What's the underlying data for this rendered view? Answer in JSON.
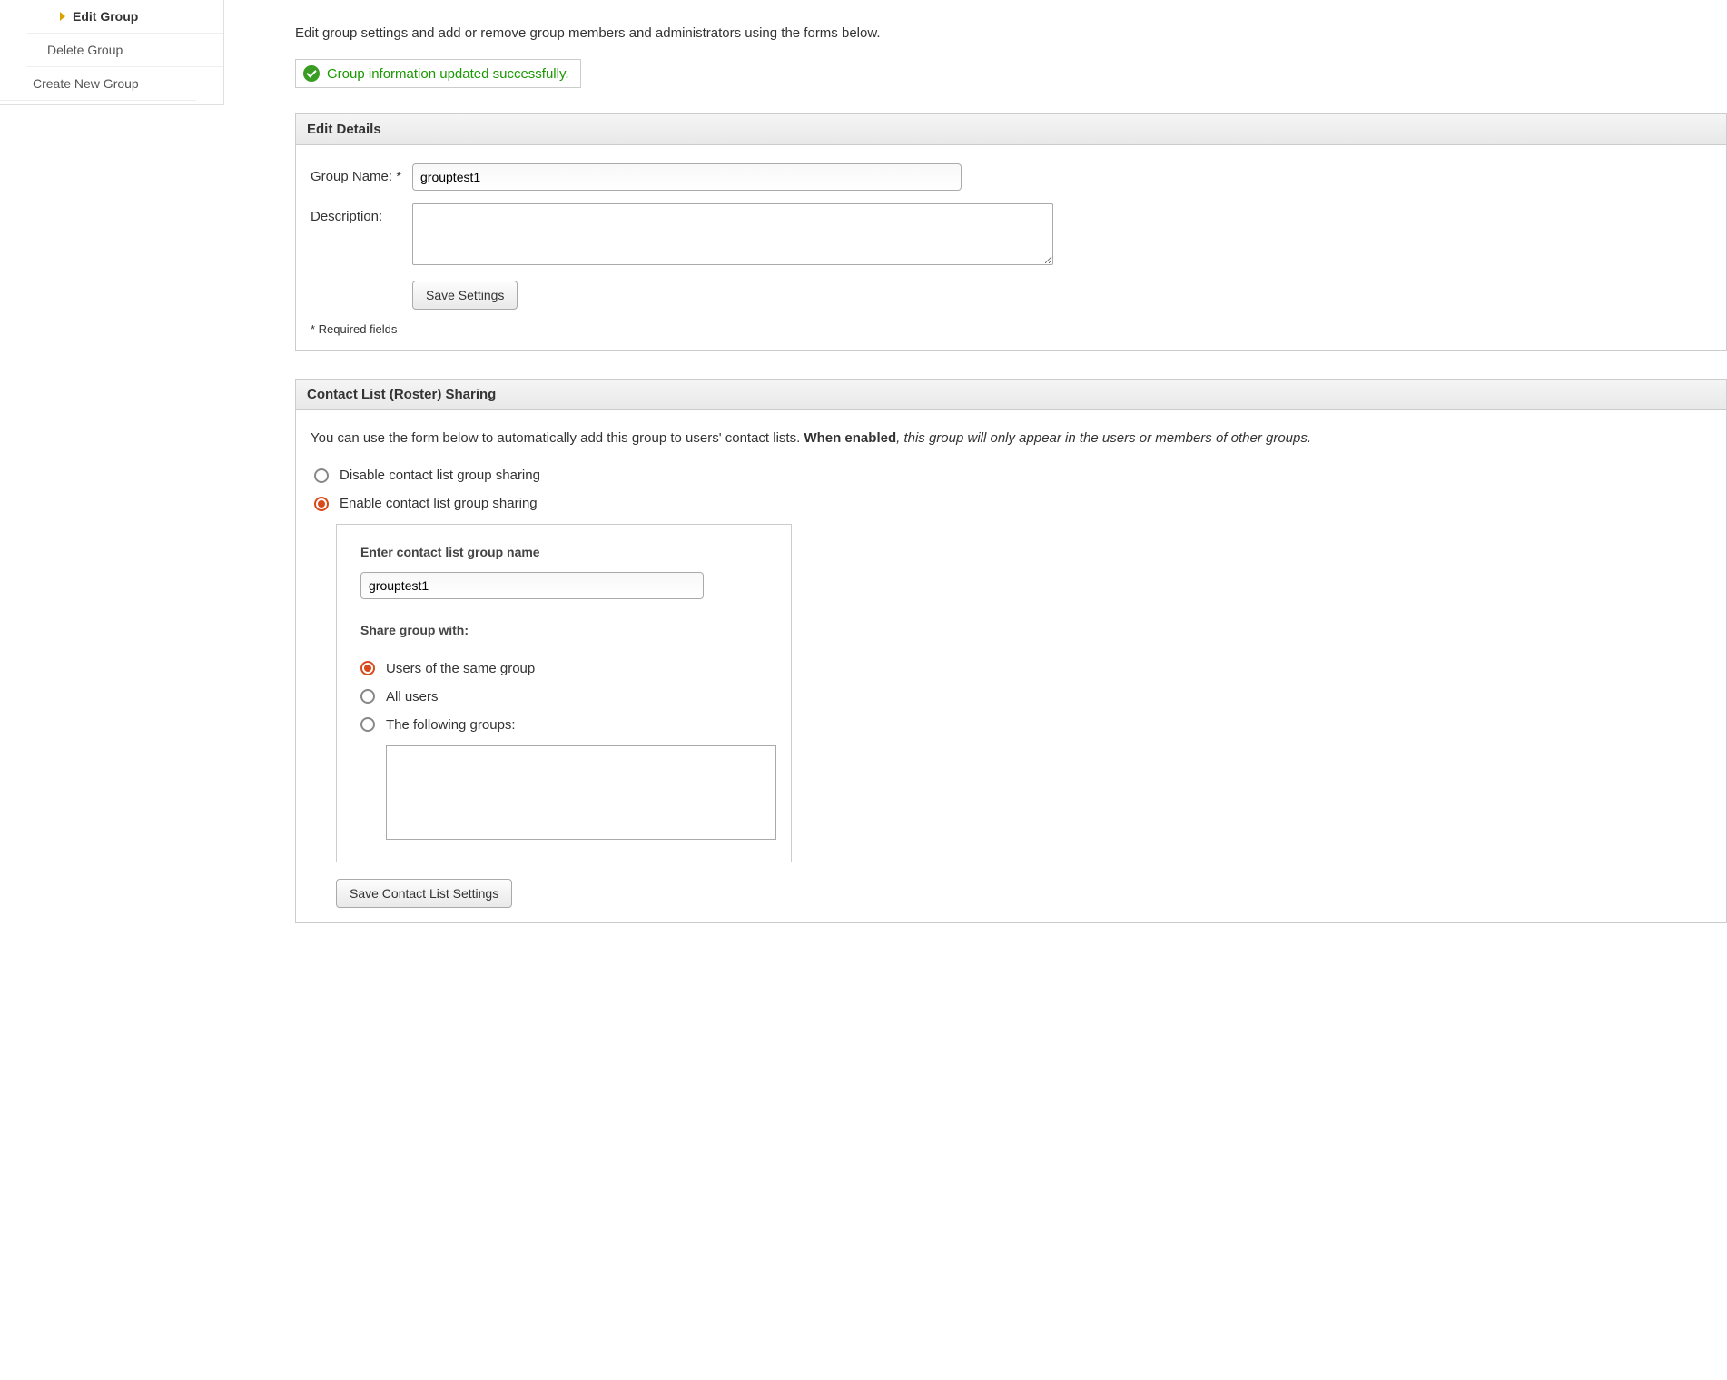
{
  "sidebar": {
    "items": [
      {
        "label": "Edit Group",
        "active": true
      },
      {
        "label": "Delete Group",
        "active": false
      },
      {
        "label": "Create New Group",
        "active": false
      }
    ]
  },
  "intro": "Edit group settings and add or remove group members and administrators using the forms below.",
  "success_message": "Group information updated successfully.",
  "edit_details": {
    "header": "Edit Details",
    "group_name_label": "Group Name: *",
    "group_name_value": "grouptest1",
    "description_label": "Description:",
    "description_value": "",
    "save_button": "Save Settings",
    "required_note": "* Required fields"
  },
  "roster_sharing": {
    "header": "Contact List (Roster) Sharing",
    "desc_prefix": "You can use the form below to automatically add this group to users' contact lists. ",
    "desc_bold": "When enabled",
    "desc_suffix": ", this group will only appear in the users or members of other groups.",
    "disable_label": "Disable contact list group sharing",
    "enable_label": "Enable contact list group sharing",
    "enabled": true,
    "group_name_label": "Enter contact list group name",
    "group_name_value": "grouptest1",
    "share_with_label": "Share group with:",
    "share_options": [
      {
        "label": "Users of the same group",
        "selected": true
      },
      {
        "label": "All users",
        "selected": false
      },
      {
        "label": "The following groups:",
        "selected": false
      }
    ],
    "save_button": "Save Contact List Settings"
  }
}
